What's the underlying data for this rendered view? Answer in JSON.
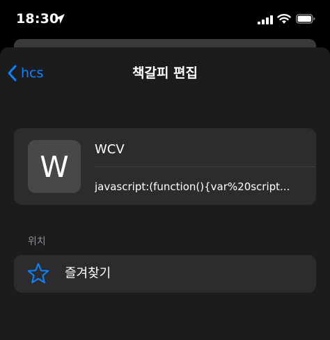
{
  "status_bar": {
    "time": "18:30",
    "icons": [
      "location-arrow-icon",
      "cellular-signal-icon",
      "wifi-icon",
      "battery-icon"
    ]
  },
  "nav": {
    "back_label": "hcs",
    "title": "책갈피 편집"
  },
  "bookmark": {
    "thumbnail_letter": "W",
    "title_value": "WCV",
    "url_value": "javascript:(function(){var%20script..."
  },
  "location": {
    "section_label": "위치",
    "folder_label": "즐겨찾기",
    "folder_icon": "star-icon"
  },
  "colors": {
    "accent": "#0a84ff",
    "sheet_background": "#1c1c1e",
    "cell_background": "#2c2c2e",
    "secondary_text": "#8e8e93"
  }
}
